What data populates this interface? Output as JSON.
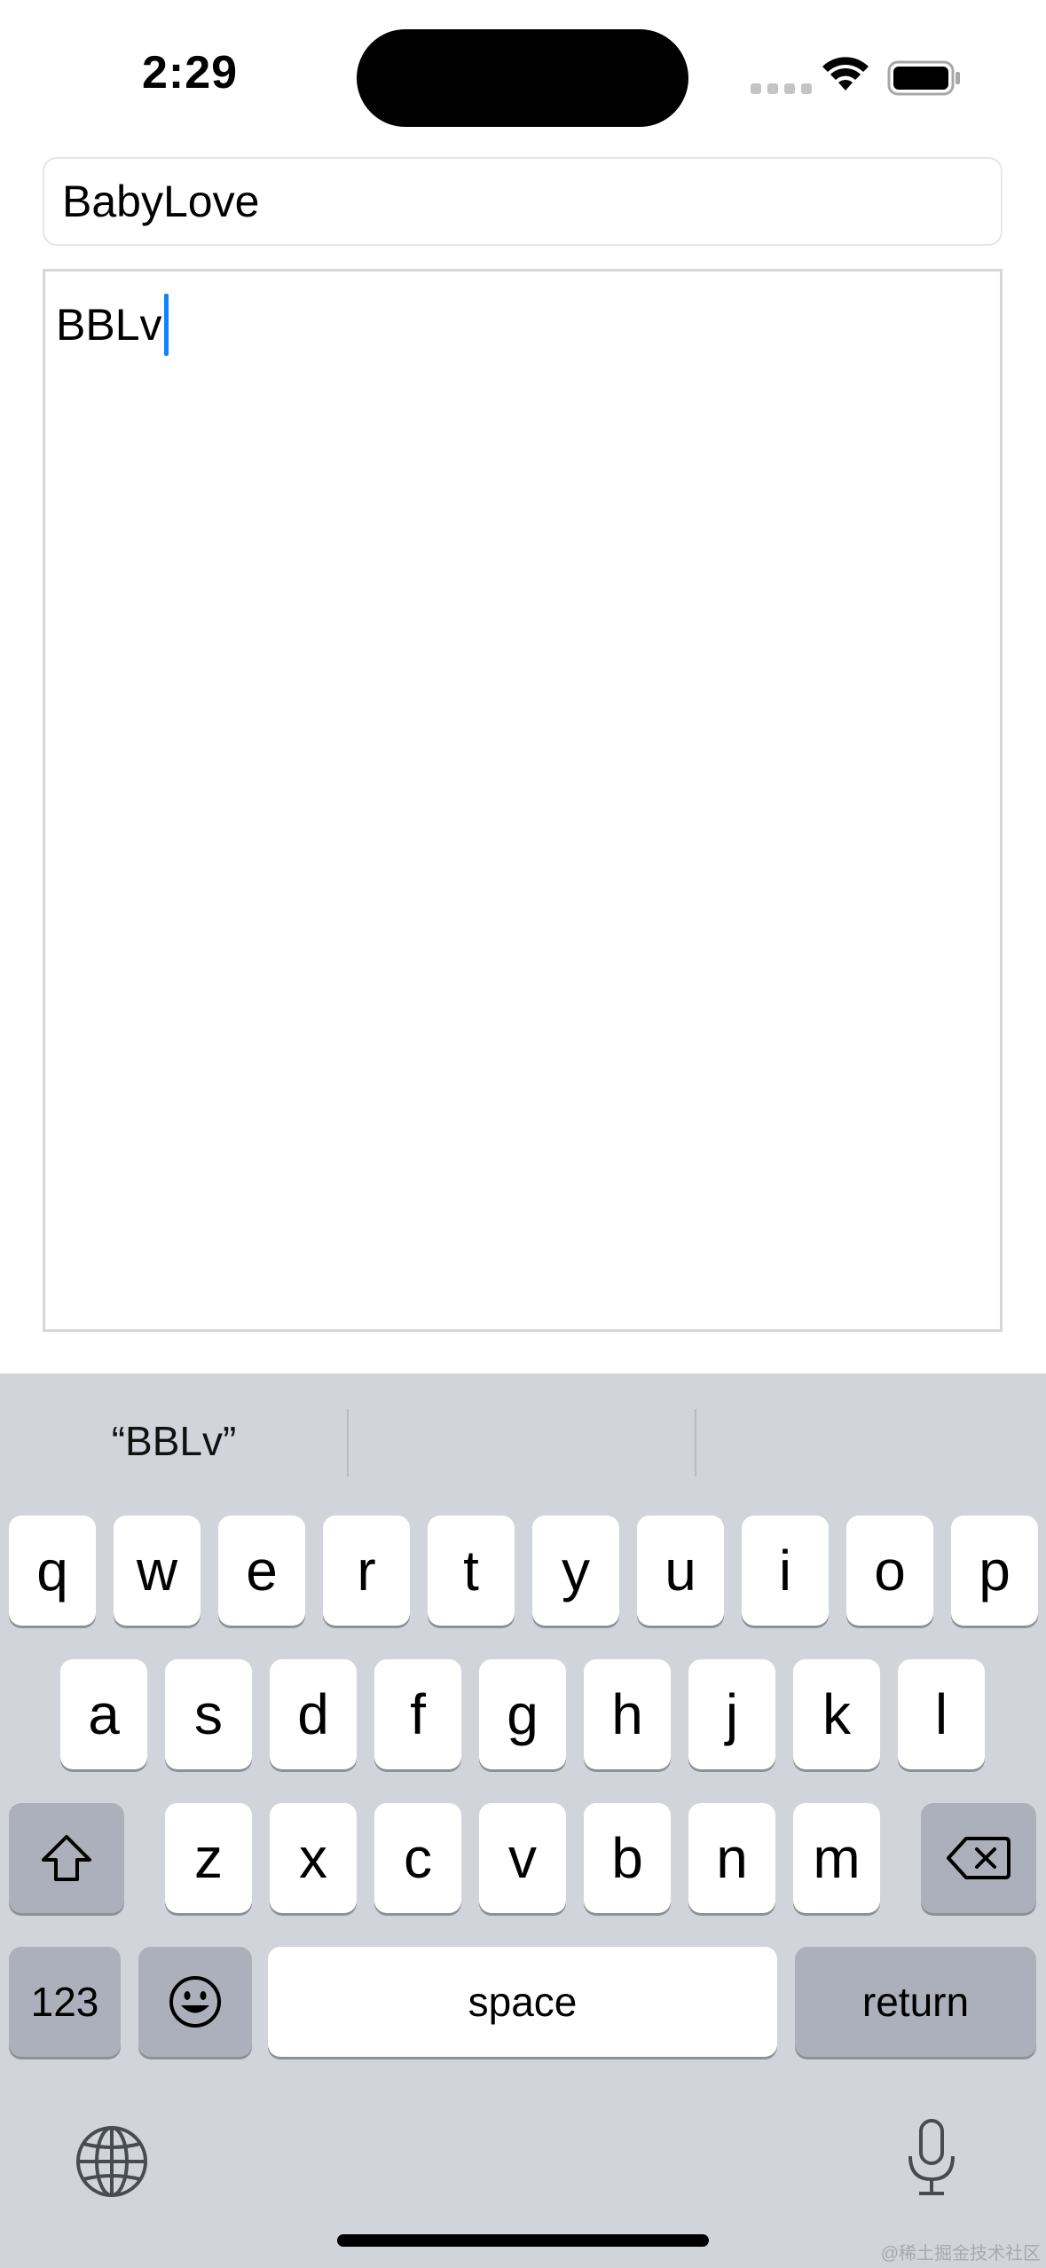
{
  "status_bar": {
    "time": "2:29",
    "wifi_icon": "wifi-icon",
    "battery_icon": "battery-icon"
  },
  "name_field": {
    "value": "BabyLove"
  },
  "text_area": {
    "value": "BBLv"
  },
  "keyboard": {
    "suggestions": [
      "“BBLv”",
      "",
      ""
    ],
    "row1": [
      "q",
      "w",
      "e",
      "r",
      "t",
      "y",
      "u",
      "i",
      "o",
      "p"
    ],
    "row2": [
      "a",
      "s",
      "d",
      "f",
      "g",
      "h",
      "j",
      "k",
      "l"
    ],
    "row3": [
      "z",
      "x",
      "c",
      "v",
      "b",
      "n",
      "m"
    ],
    "numbers_label": "123",
    "space_label": "space",
    "return_label": "return",
    "icons": [
      "shift-icon",
      "delete-icon",
      "emoji-icon",
      "globe-icon",
      "microphone-icon"
    ]
  },
  "watermark": "@稀土掘金技术社区",
  "colors": {
    "caret": "#0a84ff",
    "keyboard_bg": "#d1d4db",
    "dark_key": "#abb0bb"
  }
}
